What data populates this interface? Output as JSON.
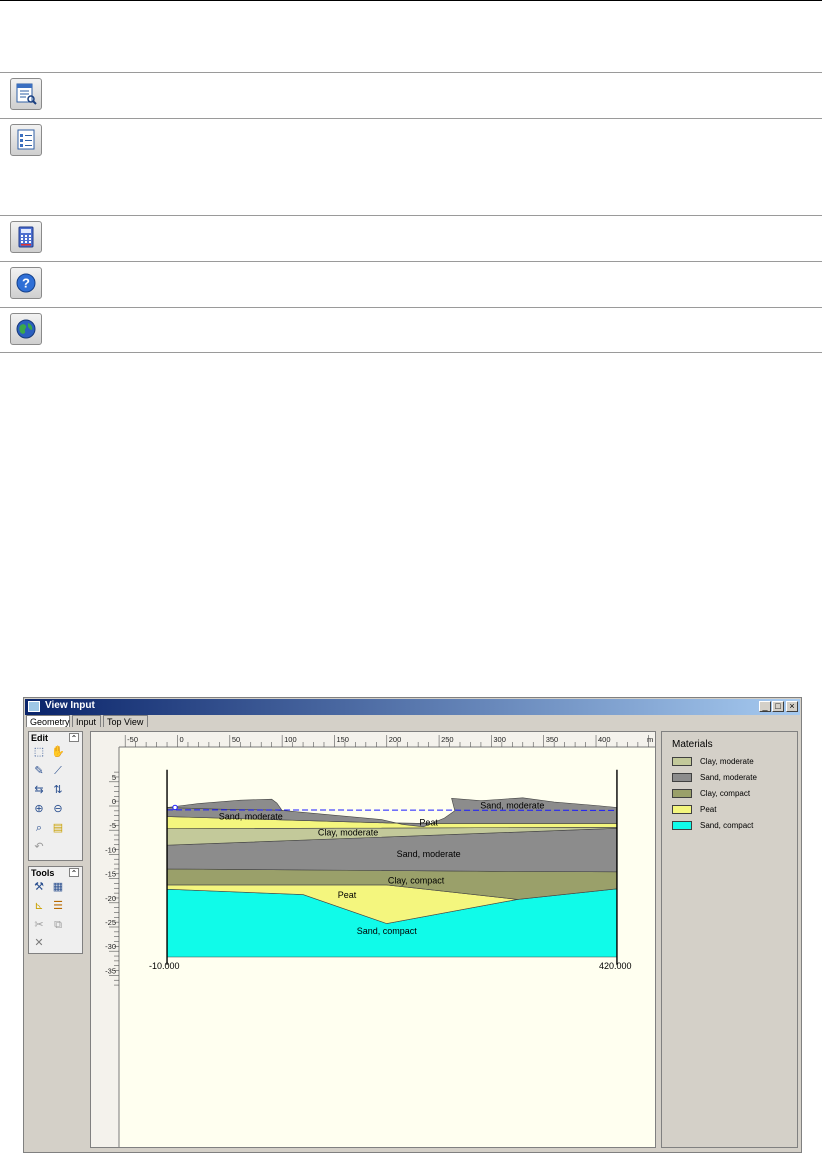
{
  "icon_rows": [
    {
      "name": "view-report-icon"
    },
    {
      "name": "list-icon"
    },
    {
      "name": "calculator-icon"
    },
    {
      "name": "help-icon"
    },
    {
      "name": "web-icon"
    }
  ],
  "window": {
    "title": "View Input",
    "tabs": [
      "Geometry",
      "Input",
      "Top View"
    ],
    "edit_label": "Edit",
    "tools_label": "Tools",
    "minimize": "_",
    "maximize": "□",
    "close": "×"
  },
  "materials_panel": {
    "title": "Materials",
    "items": [
      {
        "label": "Clay, moderate",
        "color": "#c3c99a"
      },
      {
        "label": "Sand, moderate",
        "color": "#8c8c8c"
      },
      {
        "label": "Clay, compact",
        "color": "#9aa06a"
      },
      {
        "label": "Peat",
        "color": "#f4f67e"
      },
      {
        "label": "Sand, compact",
        "color": "#10fbe9"
      }
    ]
  },
  "geometry": {
    "x_ticks": [
      -50,
      0,
      50,
      100,
      150,
      200,
      250,
      300,
      350,
      400
    ],
    "x_unit": "m",
    "y_ticks": [
      5,
      0,
      -5,
      -10,
      -15,
      -20,
      -25,
      -30,
      -35
    ],
    "left_boundary_label": "-10.000",
    "right_boundary_label": "420.000",
    "layer_labels": [
      {
        "text": "Sand, moderate",
        "x": 320,
        "y": -0.5
      },
      {
        "text": "Sand, moderate",
        "x": 70,
        "y": -2.8
      },
      {
        "text": "Peat",
        "x": 240,
        "y": -4.0
      },
      {
        "text": "Clay, moderate",
        "x": 163,
        "y": -6.1
      },
      {
        "text": "Sand, moderate",
        "x": 240,
        "y": -10.5
      },
      {
        "text": "Clay, compact",
        "x": 228,
        "y": -16.0
      },
      {
        "text": "Peat",
        "x": 162,
        "y": -19.0
      },
      {
        "text": "Sand, compact",
        "x": 200,
        "y": -26.4
      }
    ]
  }
}
